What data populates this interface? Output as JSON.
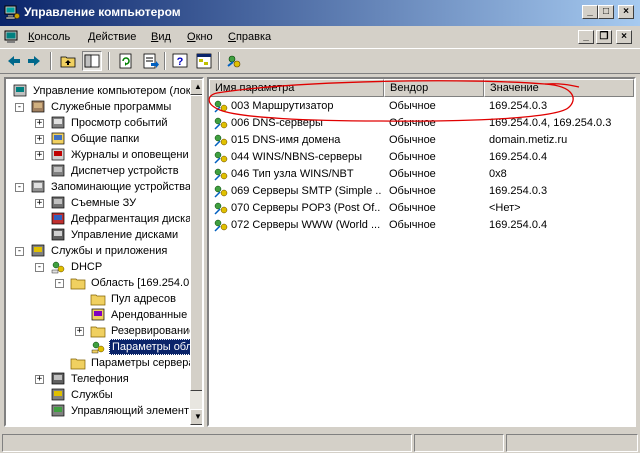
{
  "window": {
    "title": "Управление компьютером",
    "controls": {
      "minimize": "_",
      "maximize": "□",
      "close": "×"
    }
  },
  "menu": {
    "items": [
      {
        "label": "Консоль",
        "underline": "К"
      },
      {
        "label": "Действие",
        "underline": "Д"
      },
      {
        "label": "Вид",
        "underline": "В"
      },
      {
        "label": "Окно",
        "underline": "О"
      },
      {
        "label": "Справка",
        "underline": "С"
      }
    ],
    "mdi_controls": {
      "minimize": "_",
      "restore": "❐",
      "close": "×"
    }
  },
  "toolbar": {
    "buttons": [
      "back-arrow-icon",
      "forward-arrow-icon",
      "up-folder-icon",
      "show-hide-tree-icon",
      "refresh-icon",
      "export-list-icon",
      "help-icon",
      "console-tree-icon",
      "dhcp-action-icon"
    ]
  },
  "tree": {
    "items": [
      {
        "label": "Управление компьютером (лок",
        "icon": "computer-management-icon"
      },
      {
        "label": "Служебные программы",
        "icon": "system-tools-icon"
      },
      {
        "label": "Просмотр событий",
        "icon": "event-viewer-icon"
      },
      {
        "label": "Общие папки",
        "icon": "shared-folders-icon"
      },
      {
        "label": "Журналы и оповещени",
        "icon": "logs-alerts-icon"
      },
      {
        "label": "Диспетчер устройств",
        "icon": "device-manager-icon"
      },
      {
        "label": "Запоминающие устройства",
        "icon": "storage-icon"
      },
      {
        "label": "Съемные ЗУ",
        "icon": "removable-storage-icon"
      },
      {
        "label": "Дефрагментация диска",
        "icon": "defrag-icon"
      },
      {
        "label": "Управление дисками",
        "icon": "disk-management-icon"
      },
      {
        "label": "Службы и приложения",
        "icon": "services-apps-icon"
      },
      {
        "label": "DHCP",
        "icon": "dhcp-icon"
      },
      {
        "label": "Область [169.254.0",
        "icon": "folder-icon"
      },
      {
        "label": "Пул адресов",
        "icon": "folder-icon"
      },
      {
        "label": "Арендованные",
        "icon": "leases-icon"
      },
      {
        "label": "Резервирование",
        "icon": "folder-icon"
      },
      {
        "label": "Параметры обл",
        "icon": "scope-options-icon",
        "selected": true
      },
      {
        "label": "Параметры сервера",
        "icon": "folder-icon"
      },
      {
        "label": "Телефония",
        "icon": "telephony-icon"
      },
      {
        "label": "Службы",
        "icon": "services-icon"
      },
      {
        "label": "Управляющий элемент",
        "icon": "wmi-control-icon"
      }
    ]
  },
  "list": {
    "columns": [
      "Имя параметра",
      "Вендор",
      "Значение"
    ],
    "rows": [
      {
        "name": "003 Маршрутизатор",
        "vendor": "Обычное",
        "value": "169.254.0.3"
      },
      {
        "name": "006 DNS-серверы",
        "vendor": "Обычное",
        "value": "169.254.0.4, 169.254.0.3"
      },
      {
        "name": "015 DNS-имя домена",
        "vendor": "Обычное",
        "value": "domain.metiz.ru"
      },
      {
        "name": "044 WINS/NBNS-серверы",
        "vendor": "Обычное",
        "value": "169.254.0.4"
      },
      {
        "name": "046 Тип узла WINS/NBT",
        "vendor": "Обычное",
        "value": "0x8"
      },
      {
        "name": "069 Серверы SMTP (Simple ...",
        "vendor": "Обычное",
        "value": "169.254.0.3"
      },
      {
        "name": "070 Серверы POP3 (Post Of...",
        "vendor": "Обычное",
        "value": "<Нет>"
      },
      {
        "name": "072 Серверы WWW (World ...",
        "vendor": "Обычное",
        "value": "169.254.0.4"
      }
    ]
  },
  "colors": {
    "titlebar_start": "#0a246a",
    "titlebar_end": "#a6caf0",
    "annotation": "#e00000",
    "selection": "#0a246a"
  }
}
